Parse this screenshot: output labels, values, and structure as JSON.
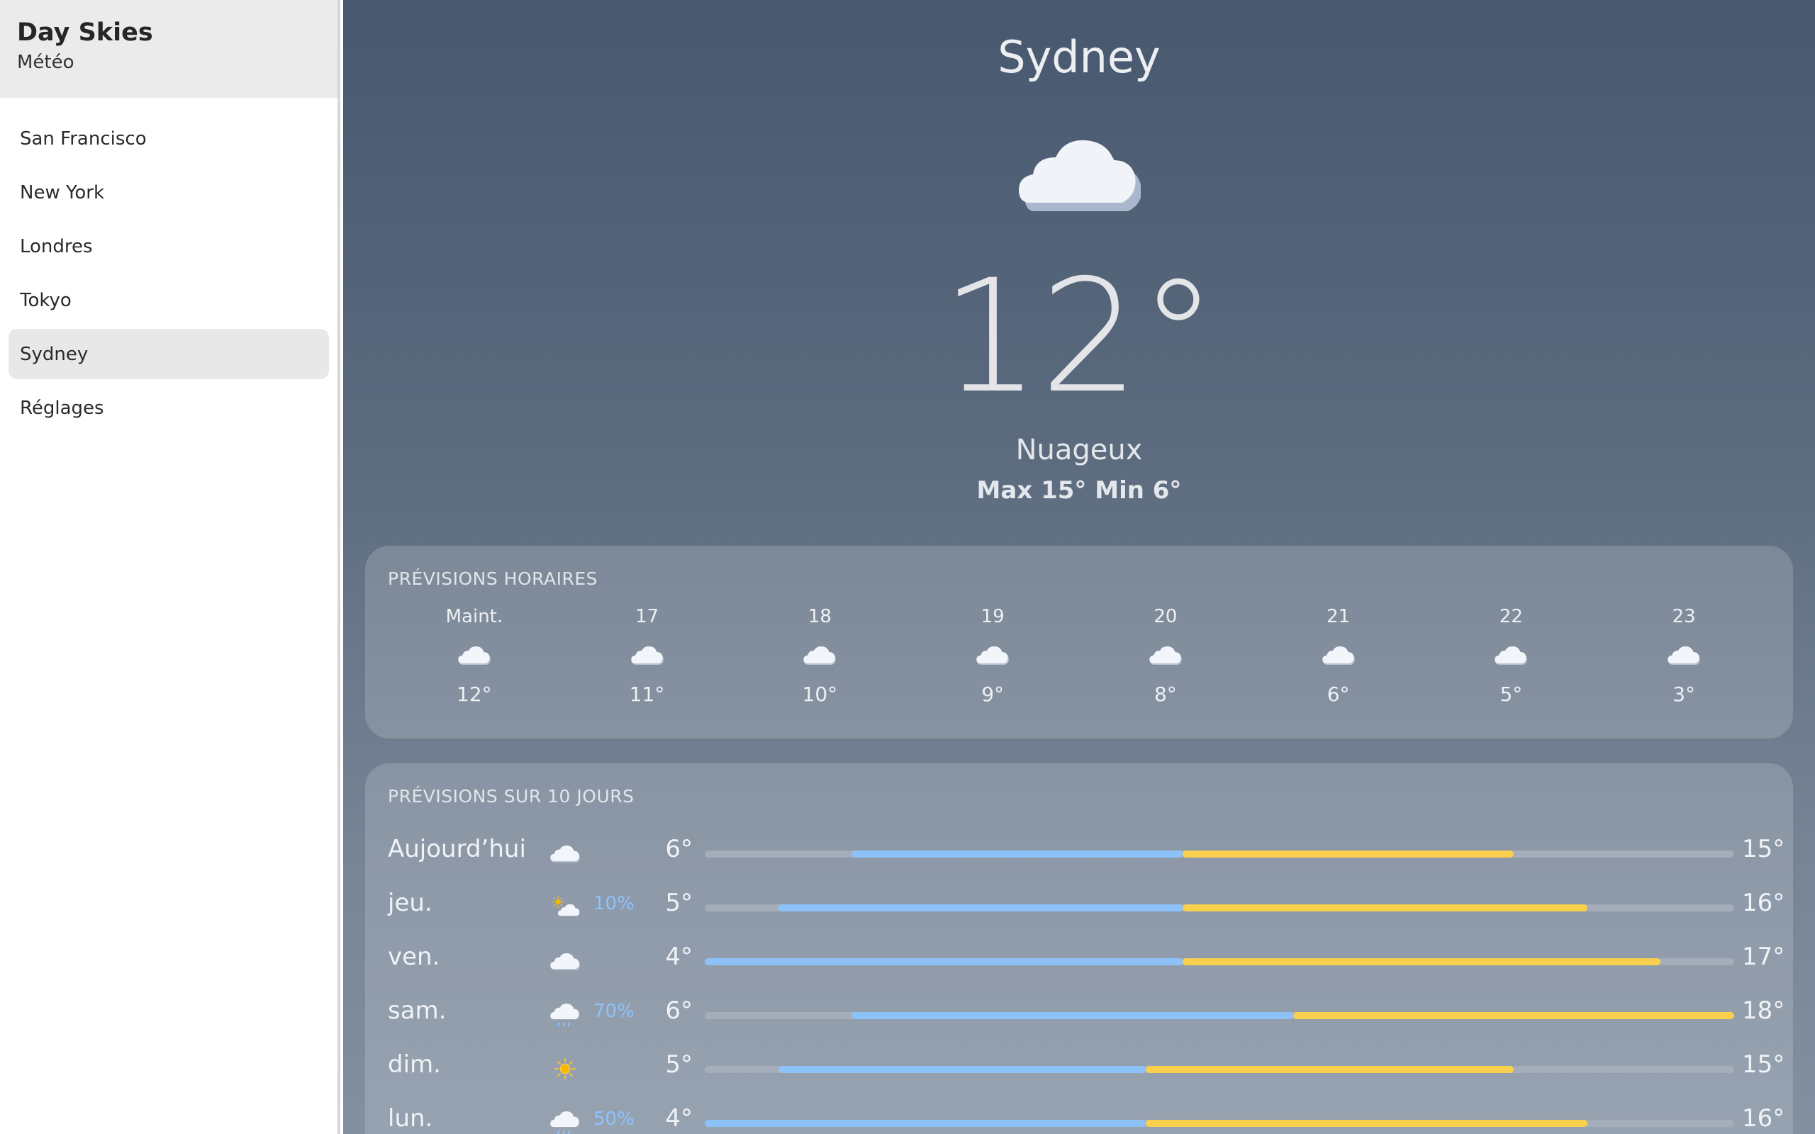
{
  "app": {
    "title": "Day Skies",
    "subtitle": "Météo"
  },
  "sidebar": {
    "items": [
      {
        "label": "San Francisco",
        "active": false
      },
      {
        "label": "New York",
        "active": false
      },
      {
        "label": "Londres",
        "active": false
      },
      {
        "label": "Tokyo",
        "active": false
      },
      {
        "label": "Sydney",
        "active": true
      },
      {
        "label": "Réglages",
        "active": false
      }
    ]
  },
  "current": {
    "city": "Sydney",
    "icon": "cloud-icon",
    "temp": "12°",
    "condition": "Nuageux",
    "hilo": "Max 15° Min 6°"
  },
  "hourly": {
    "title": "PRÉVISIONS HORAIRES",
    "hours": [
      {
        "time": "Maint.",
        "icon": "cloud-icon",
        "temp": "12°"
      },
      {
        "time": "17",
        "icon": "cloud-icon",
        "temp": "11°"
      },
      {
        "time": "18",
        "icon": "cloud-icon",
        "temp": "10°"
      },
      {
        "time": "19",
        "icon": "cloud-icon",
        "temp": "9°"
      },
      {
        "time": "20",
        "icon": "cloud-icon",
        "temp": "8°"
      },
      {
        "time": "21",
        "icon": "cloud-icon",
        "temp": "6°"
      },
      {
        "time": "22",
        "icon": "cloud-icon",
        "temp": "5°"
      },
      {
        "time": "23",
        "icon": "cloud-icon",
        "temp": "3°"
      }
    ]
  },
  "daily": {
    "title": "PRÉVISIONS SUR 10 JOURS",
    "scale": {
      "min": 4,
      "max": 18
    },
    "days": [
      {
        "name": "Aujourd’hui",
        "icon": "cloud-icon",
        "precip": "",
        "low": 6,
        "high": 15,
        "low_label": "6°",
        "high_label": "15°"
      },
      {
        "name": "jeu.",
        "icon": "partly-sunny-icon",
        "precip": "10%",
        "low": 5,
        "high": 16,
        "low_label": "5°",
        "high_label": "16°"
      },
      {
        "name": "ven.",
        "icon": "cloud-icon",
        "precip": "",
        "low": 4,
        "high": 17,
        "low_label": "4°",
        "high_label": "17°"
      },
      {
        "name": "sam.",
        "icon": "rain-icon",
        "precip": "70%",
        "low": 6,
        "high": 18,
        "low_label": "6°",
        "high_label": "18°"
      },
      {
        "name": "dim.",
        "icon": "sun-icon",
        "precip": "",
        "low": 5,
        "high": 15,
        "low_label": "5°",
        "high_label": "15°"
      },
      {
        "name": "lun.",
        "icon": "rain-icon",
        "precip": "50%",
        "low": 4,
        "high": 16,
        "low_label": "4°",
        "high_label": "16°"
      }
    ]
  },
  "colors": {
    "cold": "#8dc2f8",
    "warm": "#f9d04e",
    "precip": "#8cc3ff"
  }
}
